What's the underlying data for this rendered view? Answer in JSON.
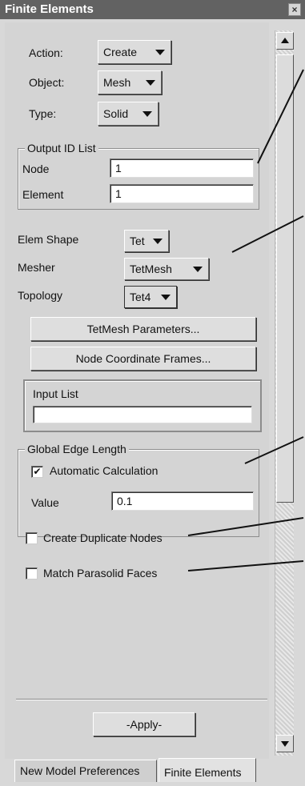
{
  "window": {
    "title": "Finite Elements",
    "close_glyph": "×"
  },
  "form": {
    "action": {
      "label": "Action:",
      "value": "Create"
    },
    "object": {
      "label": "Object:",
      "value": "Mesh"
    },
    "type": {
      "label": "Type:",
      "value": "Solid"
    },
    "output_id_list": {
      "legend": "Output ID List",
      "node_label": "Node",
      "node_value": "1",
      "element_label": "Element",
      "element_value": "1"
    },
    "elem_shape": {
      "label": "Elem Shape",
      "value": "Tet"
    },
    "mesher": {
      "label": "Mesher",
      "value": "TetMesh"
    },
    "topology": {
      "label": "Topology",
      "value": "Tet4"
    },
    "tetmesh_params_button": "TetMesh Parameters...",
    "node_coord_frames_button": "Node Coordinate Frames...",
    "input_list": {
      "legend": "Input List",
      "value": ""
    },
    "global_edge_length": {
      "legend": "Global Edge Length",
      "auto_calc_label": "Automatic Calculation",
      "auto_calc_checked": true,
      "value_label": "Value",
      "value": "0.1"
    },
    "create_duplicate_nodes": {
      "label": "Create Duplicate Nodes",
      "checked": false
    },
    "match_parasolid_faces": {
      "label": "Match Parasolid Faces",
      "checked": false
    },
    "apply_button": "-Apply-"
  },
  "tabs": [
    {
      "label": "New Model Preferences",
      "active": false
    },
    {
      "label": "Finite Elements",
      "active": true
    }
  ],
  "icons": {
    "dropdown": "triangle-down-icon",
    "check": "checkmark-icon",
    "scroll_up": "arrow-up-icon",
    "scroll_down": "arrow-down-icon"
  }
}
